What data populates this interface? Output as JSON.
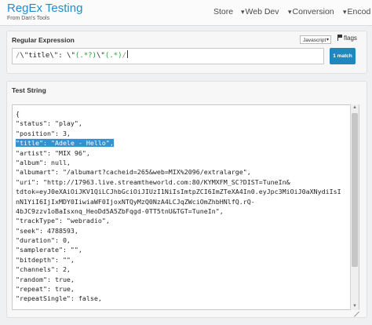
{
  "header": {
    "title": "RegEx Testing",
    "subtitle": "From Dan's Tools",
    "nav": [
      "Store",
      "Web Dev",
      "Conversion",
      "Encod"
    ]
  },
  "regex_panel": {
    "label": "Regular Expression",
    "language": "Javascript",
    "flags_label": "flags",
    "pattern": {
      "open_delim": "/",
      "part1": "\\\"title\\\": \\\"",
      "group1": "(.*?)",
      "part2": "\\\"",
      "group2": "(.*)",
      "close_delim": "/"
    },
    "match_button": "1 match"
  },
  "test_panel": {
    "label": "Test String",
    "lines_before": [
      "{",
      "  \"status\": \"play\",",
      "  \"position\": 3,"
    ],
    "highlight_line_text": "\"title\": \"Adele - Hello\",",
    "lines_after": [
      "  \"artist\": \"MIX 96\",",
      "  \"album\": null,",
      "  \"albumart\": \"/albumart?cacheid=265&web=MIX%2096/extralarge\",",
      "  \"uri\": \"http://17963.live.streamtheworld.com:80/KYMXFM_SC?DIST=TuneIn&",
      "tdtok=eyJ0eXAiOiJKV1QiLCJhbGciOiJIUzI1NiIsImtpZCI6ImZTeXA4In0.eyJpc3MiOiJ0aXNydiIsI",
      "nN1YiI6IjIxMDY0IiwiaWF0IjoxNTQyMzQ0NzA4LCJqZWciOmZhbHNlfQ.rQ-",
      "4bJC9zzv1oBaIsxnq_HeoDd5A5ZbFqgd-0TT5tnU&TGT=TuneIn\",",
      "  \"trackType\": \"webradio\",",
      "  \"seek\": 4788593,",
      "  \"duration\": 0,",
      "  \"samplerate\": \"\",",
      "  \"bitdepth\": \"\",",
      "  \"channels\": 2,",
      "  \"random\": true,",
      "  \"repeat\": true,",
      "  \"repeatSingle\": false,"
    ]
  },
  "colors": {
    "brand": "#1f8ec8",
    "match_button": "#1f88bf",
    "highlight": "#3591cf",
    "regex_group": "#2a9d36"
  }
}
